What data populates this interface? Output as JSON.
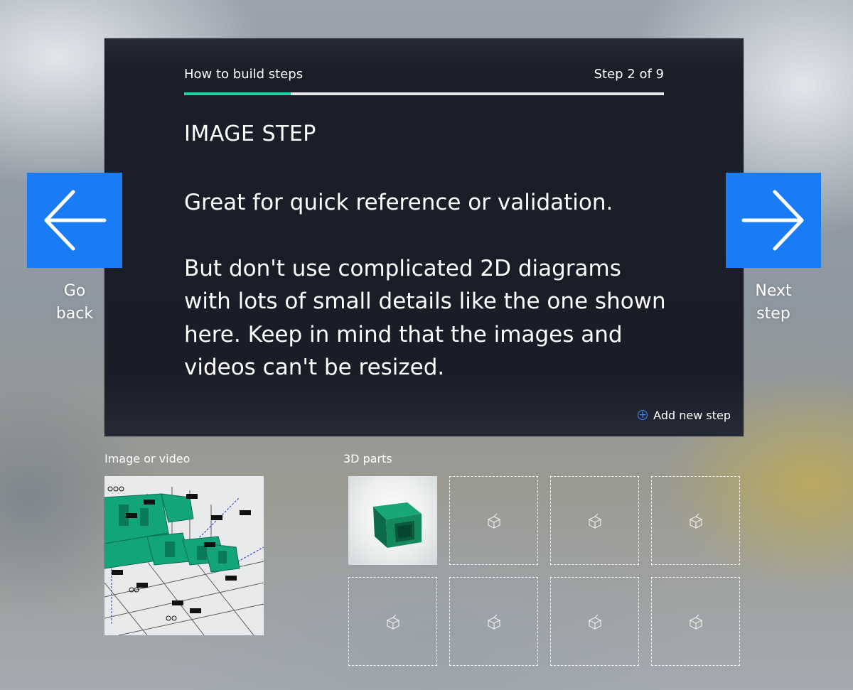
{
  "card": {
    "header_title": "How to build steps",
    "step_counter": "Step 2 of 9",
    "progress_fraction": 0.222,
    "step_title": "IMAGE STEP",
    "body_paragraph_1": "Great for quick reference or validation.",
    "body_paragraph_2": "But don't use complicated 2D diagrams with lots of small details like the one shown here. Keep in mind that the images and videos can't be resized.",
    "add_step_label": "Add new step"
  },
  "navigation": {
    "back_label": "Go back",
    "next_label": "Next step"
  },
  "media": {
    "label": "Image or video"
  },
  "parts": {
    "label": "3D parts",
    "slots": [
      "filled",
      "empty",
      "empty",
      "empty",
      "empty",
      "empty",
      "empty",
      "empty"
    ]
  },
  "colors": {
    "accent_blue": "#1a7cf5",
    "progress_teal": "#1fd3a6",
    "card_background": "#1b1e29",
    "part_green": "#0f8a5a"
  },
  "icons": {
    "back": "arrow-left-icon",
    "next": "arrow-right-icon",
    "add": "plus-circle-icon",
    "empty_slot": "cube-placeholder-icon"
  }
}
